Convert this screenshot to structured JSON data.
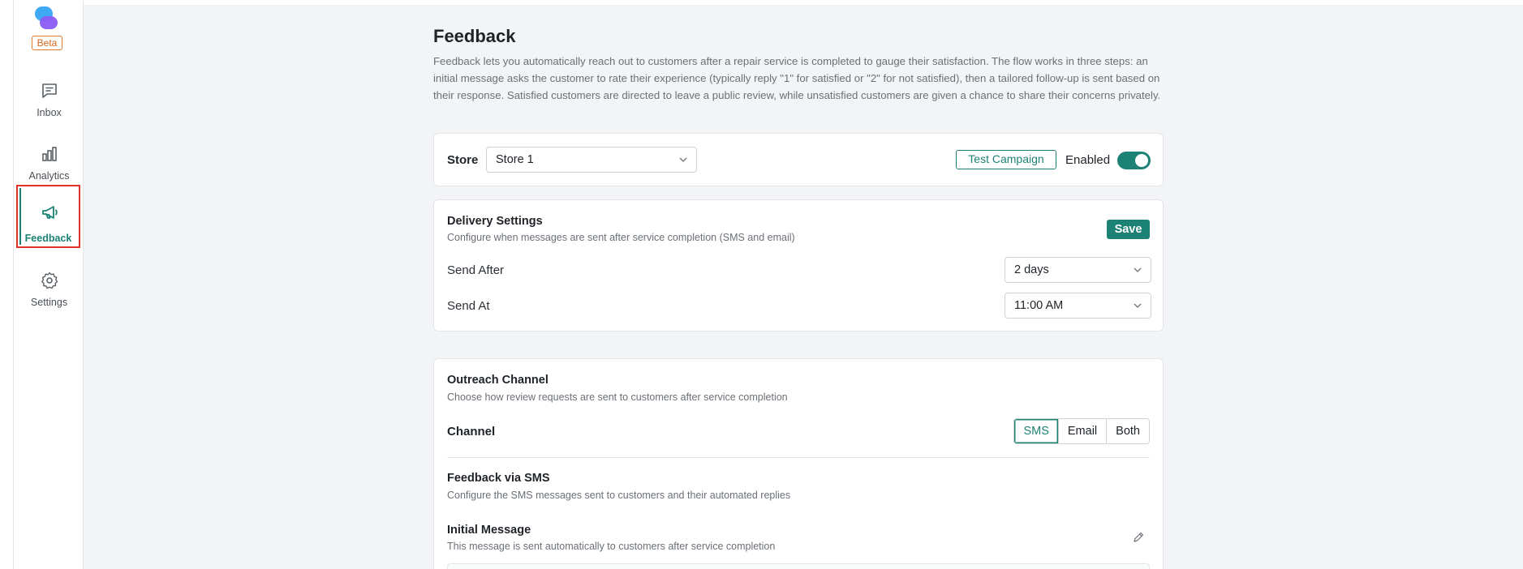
{
  "sidebar": {
    "badge": "Beta",
    "items": [
      {
        "label": "Inbox",
        "icon": "inbox-icon"
      },
      {
        "label": "Analytics",
        "icon": "bar-chart-icon"
      },
      {
        "label": "Feedback",
        "icon": "megaphone-icon",
        "active": true
      },
      {
        "label": "Settings",
        "icon": "gear-icon"
      }
    ]
  },
  "page": {
    "title": "Feedback",
    "description": "Feedback lets you automatically reach out to customers after a repair service is completed to gauge their satisfaction. The flow works in three steps: an initial message asks the customer to rate their experience (typically reply \"1\" for satisfied or \"2\" for not satisfied), then a tailored follow-up is sent based on their response. Satisfied customers are directed to leave a public review, while unsatisfied customers are given a chance to share their concerns privately."
  },
  "store_card": {
    "label": "Store",
    "selected": "Store 1",
    "test_button": "Test Campaign",
    "enabled_label": "Enabled",
    "enabled": true
  },
  "delivery": {
    "title": "Delivery Settings",
    "subtitle": "Configure when messages are sent after service completion (SMS and email)",
    "save_label": "Save",
    "send_after_label": "Send After",
    "send_after_value": "2 days",
    "send_at_label": "Send At",
    "send_at_value": "11:00 AM"
  },
  "outreach": {
    "title": "Outreach Channel",
    "subtitle": "Choose how review requests are sent to customers after service completion",
    "channel_label": "Channel",
    "options": [
      "SMS",
      "Email",
      "Both"
    ],
    "selected": "SMS",
    "sms_title": "Feedback via SMS",
    "sms_subtitle": "Configure the SMS messages sent to customers and their automated replies",
    "initial_title": "Initial Message",
    "initial_subtitle": "This message is sent automatically to customers after service completion"
  },
  "colors": {
    "accent": "#1c8275",
    "beta": "#d4661b",
    "highlight": "#e0342b"
  }
}
